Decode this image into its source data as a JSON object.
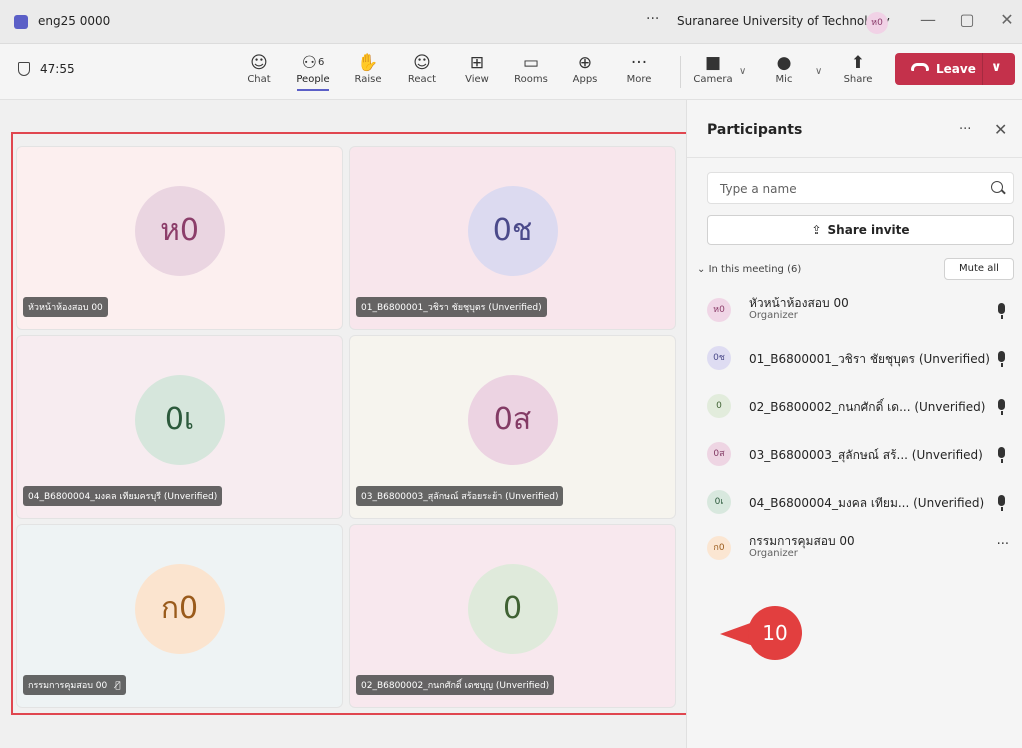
{
  "titlebar": {
    "title": "eng25 0000",
    "more": "···",
    "organization": "Suranaree University of Technology",
    "avatar_initials": "ห0",
    "minimize": "—",
    "maximize": "▢",
    "close": "✕"
  },
  "toolbar": {
    "timer": "47:55",
    "buttons": [
      {
        "label": "Chat",
        "icon": "☺"
      },
      {
        "label": "People",
        "icon": "⚇",
        "count": "6"
      },
      {
        "label": "Raise",
        "icon": "✋"
      },
      {
        "label": "React",
        "icon": "☺"
      },
      {
        "label": "View",
        "icon": "⊞"
      },
      {
        "label": "Rooms",
        "icon": "▭"
      },
      {
        "label": "Apps",
        "icon": "⊕"
      },
      {
        "label": "More",
        "icon": "···"
      },
      {
        "label": "Camera",
        "icon": "■"
      },
      {
        "label": "Mic",
        "icon": "●"
      },
      {
        "label": "Share",
        "icon": "⬆"
      }
    ],
    "leave_label": "Leave",
    "chevron": "∨"
  },
  "tiles": [
    {
      "initials": "ห0",
      "name": "หัวหน้าห้องสอบ 00",
      "bg": "#fcefef",
      "circle_bg": "#ead5e1",
      "circle_fg": "#8c3e6a"
    },
    {
      "initials": "0ช",
      "name": "01_B6800001_วชิรา ชัยชุบุตร (Unverified)",
      "bg": "#f8e6ec",
      "circle_bg": "#dcdaf0",
      "circle_fg": "#4b4a8a"
    },
    {
      "initials": "0เ",
      "name": "04_B6800004_มงคล เทียมครบุรี (Unverified)",
      "bg": "#f7ecf0",
      "circle_bg": "#d6e6dc",
      "circle_fg": "#2c5a3c"
    },
    {
      "initials": "0ส",
      "name": "03_B6800003_สุลักษณ์ สร้อยระย้า (Unverified)",
      "bg": "#f6f4ee",
      "circle_bg": "#ecd3e2",
      "circle_fg": "#833b65"
    },
    {
      "initials": "ก0",
      "name": "กรรมการคุมสอบ 00",
      "bg": "#eef3f4",
      "circle_bg": "#fbe4cf",
      "circle_fg": "#9a5b1c",
      "muted_icon": "mic-off-icon"
    },
    {
      "initials": "0",
      "name": "02_B6800002_กนกศักดิ์ เดชบุญ (Unverified)",
      "bg": "#f8e8ee",
      "circle_bg": "#dfeadb",
      "circle_fg": "#3f6233"
    }
  ],
  "participants_panel": {
    "title": "Participants",
    "more": "···",
    "close": "✕",
    "search_placeholder": "Type a name",
    "share_invite": "Share invite",
    "section_label": "In this meeting (6)",
    "mute_all": "Mute all",
    "people": [
      {
        "initials": "ห0",
        "name": "หัวหน้าห้องสอบ 00",
        "role": "Organizer",
        "avatar_bg": "#f0d6e6",
        "avatar_fg": "#8c3e6a",
        "action": "mic-icon"
      },
      {
        "initials": "0ช",
        "name": "01_B6800001_วชิรา ชัยชุบุตร (Unverified)",
        "role": "",
        "avatar_bg": "#dedcf2",
        "avatar_fg": "#4b4a8a",
        "action": "mic-icon"
      },
      {
        "initials": "0",
        "name": "02_B6800002_กนกศักดิ์ เด... (Unverified)",
        "role": "",
        "avatar_bg": "#e2ecdc",
        "avatar_fg": "#3f6233",
        "action": "mic-icon"
      },
      {
        "initials": "0ส",
        "name": "03_B6800003_สุลักษณ์ สร้... (Unverified)",
        "role": "",
        "avatar_bg": "#eed5e3",
        "avatar_fg": "#833b65",
        "action": "mic-icon"
      },
      {
        "initials": "0เ",
        "name": "04_B6800004_มงคล เทียม... (Unverified)",
        "role": "",
        "avatar_bg": "#d8e8de",
        "avatar_fg": "#2c5a3c",
        "action": "mic-icon"
      },
      {
        "initials": "ก0",
        "name": "กรรมการคุมสอบ 00",
        "role": "Organizer",
        "avatar_bg": "#fbe6d2",
        "avatar_fg": "#9a5b1c",
        "action": "more-icon"
      }
    ]
  },
  "annotation": {
    "callout_number": "10",
    "color": "#e23f3f"
  }
}
